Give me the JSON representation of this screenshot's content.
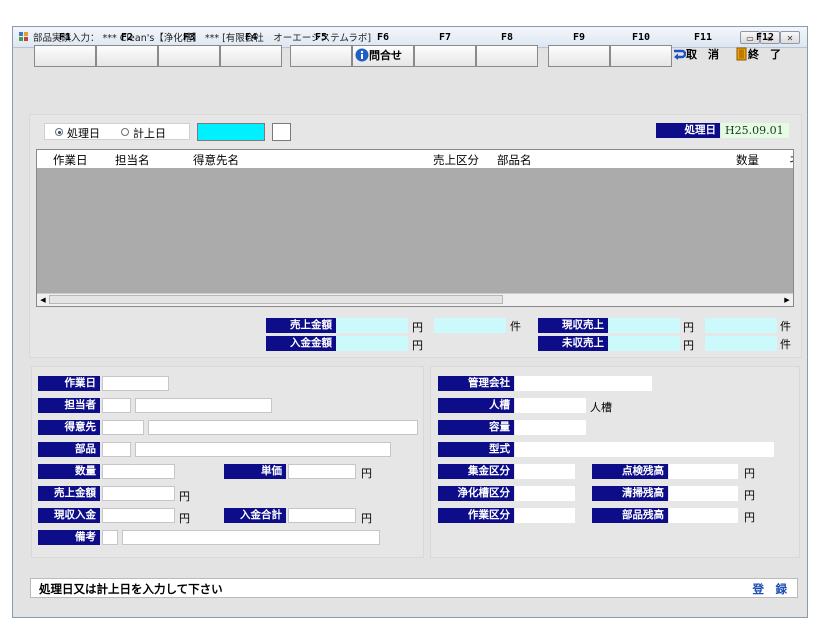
{
  "window": {
    "title": "部品実績入力： *** Clean's【浄化槽】 *** [有限会社　オーエーシステムラボ]",
    "minimize_glyph": "▭",
    "maximize_glyph": "▫",
    "close_glyph": "✕"
  },
  "fkeys": [
    {
      "key": "F1",
      "label": ""
    },
    {
      "key": "F2",
      "label": ""
    },
    {
      "key": "F3",
      "label": ""
    },
    {
      "key": "F4",
      "label": ""
    },
    {
      "key": "F5",
      "label": ""
    },
    {
      "key": "F6",
      "label": "問合せ",
      "icon": "info-icon"
    },
    {
      "key": "F7",
      "label": ""
    },
    {
      "key": "F8",
      "label": ""
    },
    {
      "key": "F9",
      "label": ""
    },
    {
      "key": "F10",
      "label": ""
    },
    {
      "key": "F11",
      "label": "取　消",
      "icon": "undo-arrow-icon"
    },
    {
      "key": "F12",
      "label": "終　了",
      "icon": "exit-door-icon"
    }
  ],
  "filter": {
    "radio_processing": "処理日",
    "radio_posting": "計上日",
    "selected": "処理日",
    "processing_date_label": "処理日",
    "processing_date_value": "H25.09.01"
  },
  "grid": {
    "columns": [
      "作業日",
      "担当名",
      "得意先名",
      "売上区分",
      "部品名",
      "数量",
      "ネ"
    ],
    "rows": []
  },
  "totals": {
    "sales_amount_label": "売上金額",
    "deposit_amount_label": "入金金額",
    "cash_sales_label": "現収売上",
    "uncollected_sales_label": "未収売上",
    "yen": "円",
    "count_unit": "件"
  },
  "left_form": {
    "work_date": "作業日",
    "person": "担当者",
    "customer": "得意先",
    "part": "部品",
    "quantity": "数量",
    "unit_price": "単価",
    "sales_amount": "売上金額",
    "cash_deposit": "現収入金",
    "deposit_total": "入金合計",
    "remarks": "備考",
    "yen": "円"
  },
  "right_form": {
    "management_company": "管理会社",
    "capacity_people": "人槽",
    "capacity_people_unit": "人槽",
    "volume": "容量",
    "model": "型式",
    "collection_type": "集金区分",
    "tank_type": "浄化槽区分",
    "work_type": "作業区分",
    "inspection_balance": "点検残高",
    "cleaning_balance": "清掃残高",
    "parts_balance": "部品残高",
    "yen": "円"
  },
  "status": {
    "message": "処理日又は計上日を入力して下さい",
    "register": "登　録"
  },
  "colors": {
    "label_navy": "#0d0d8a",
    "cyan_field": "#ccf9fb",
    "grid_body": "#ababab",
    "date_green_bg": "#e4fbe4"
  }
}
